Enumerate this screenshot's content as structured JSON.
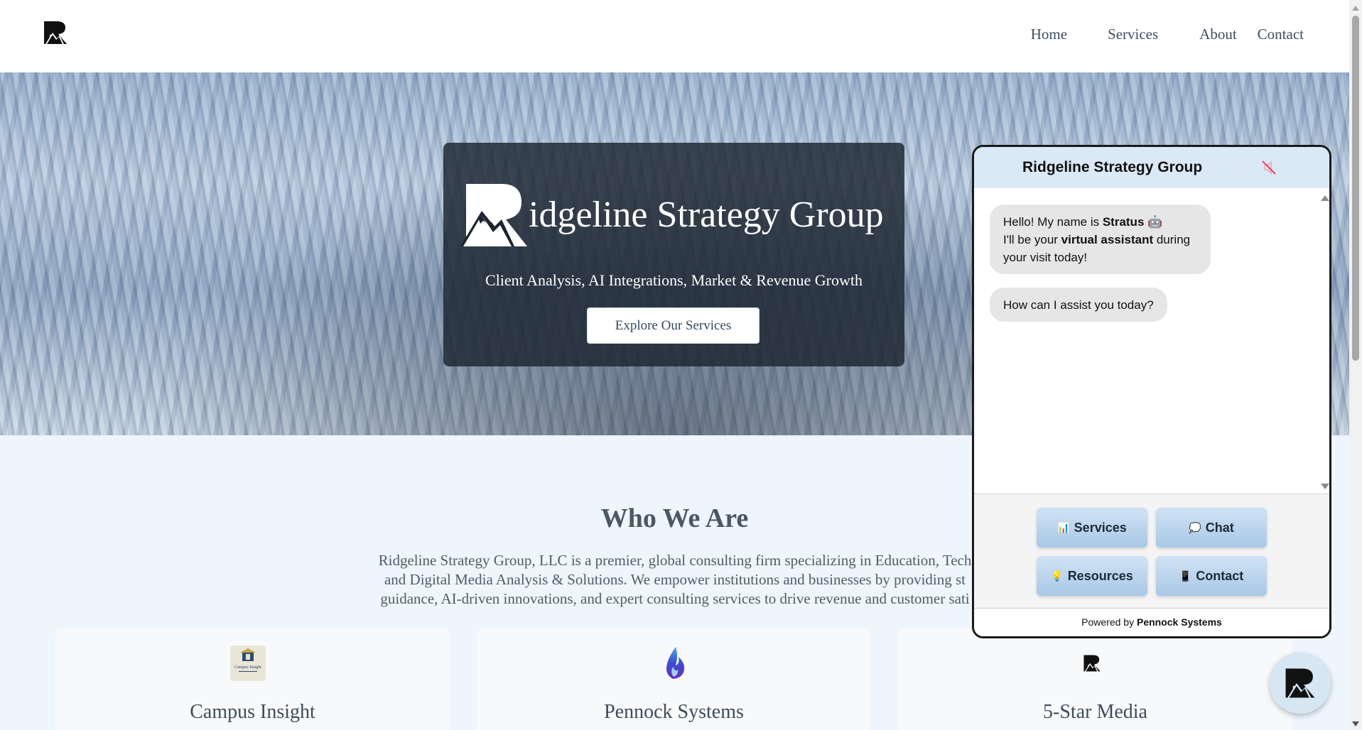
{
  "header": {
    "nav": [
      "Home",
      "Services",
      "About",
      "Contact"
    ]
  },
  "hero": {
    "title": "idgeline Strategy Group",
    "subtitle": "Client Analysis, AI Integrations, Market & Revenue Growth",
    "cta": "Explore Our Services"
  },
  "about": {
    "title": "Who We Are",
    "lines": [
      "Ridgeline Strategy Group, LLC is a premier, global consulting firm specializing in Education, Tech",
      "and Digital Media Analysis & Solutions. We empower institutions and businesses by providing st",
      "guidance, AI-driven innovations, and expert consulting services to drive revenue and customer sati"
    ]
  },
  "cards": [
    {
      "title": "Campus Insight",
      "icon": "campus-insight-logo-icon",
      "logo_text": "Campus Insight"
    },
    {
      "title": "Pennock Systems",
      "icon": "flame-icon"
    },
    {
      "title": "5-Star Media",
      "icon": "ridgeline-logo-icon"
    }
  ],
  "chat": {
    "title": "Ridgeline Strategy Group",
    "refresh_icon": "↻",
    "messages": [
      {
        "parts": [
          "Hello! My name is ",
          "Stratus",
          " 🤖",
          "I'll be your ",
          "virtual assistant",
          " during your visit today!"
        ]
      },
      {
        "text": "How can I assist you today?"
      }
    ],
    "buttons": [
      {
        "icon": "📊",
        "label": "Services"
      },
      {
        "icon": "💭",
        "label": "Chat"
      },
      {
        "icon": "💡",
        "label": "Resources"
      },
      {
        "icon": "📱",
        "label": "Contact"
      }
    ],
    "footer_prefix": "Powered by ",
    "footer_brand": "Pennock Systems"
  },
  "colors": {
    "hero_overlay": "#1c2430",
    "section_bg": "#eef5fd",
    "chat_header": "#dbe9f7",
    "chat_button": "#a9c8e6"
  }
}
